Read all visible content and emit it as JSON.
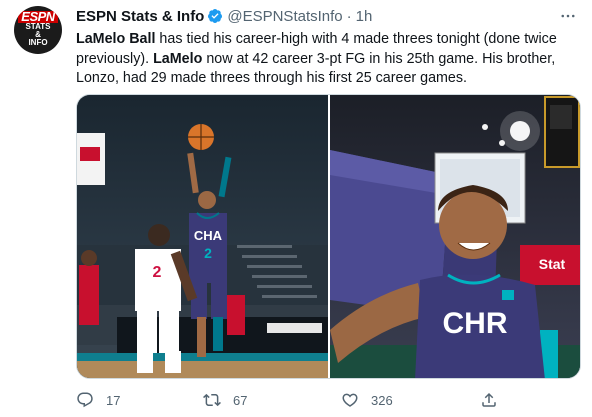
{
  "tweet": {
    "display_name": "ESPN Stats & Info",
    "handle": "@ESPNStatsInfo",
    "separator": "·",
    "time": "1h",
    "text": {
      "p1_bold": "LaMelo Ball",
      "p1_rest": " has tied his career-high with 4 made threes tonight (done twice previously). ",
      "p2_bold": "LaMelo",
      "p2_rest": " now at 42 career 3-pt FG in his 25th game. His brother, Lonzo, had 29 made threes through his first 25 career games."
    },
    "avatar": {
      "logo": "ESPN",
      "line1": "STATS",
      "line2": "&",
      "line3": "INFO"
    },
    "photo_left": {
      "jersey_shooter_team": "CHA",
      "jersey_shooter_number": "2",
      "jersey_defender_number": "2"
    },
    "photo_right": {
      "jersey_team": "CHR",
      "banner_text": "Stat"
    },
    "actions": {
      "reply_count": "17",
      "retweet_count": "67",
      "like_count": "326"
    }
  },
  "colors": {
    "text": "#0f1419",
    "secondary": "#536471",
    "verified": "#1d9bf0",
    "hornets_teal": "#00788c",
    "hornets_purple": "#3b3a78",
    "rockets_red": "#ce1141"
  },
  "icons": [
    "more-icon",
    "verified-icon",
    "reply-icon",
    "retweet-icon",
    "like-icon",
    "share-icon"
  ]
}
